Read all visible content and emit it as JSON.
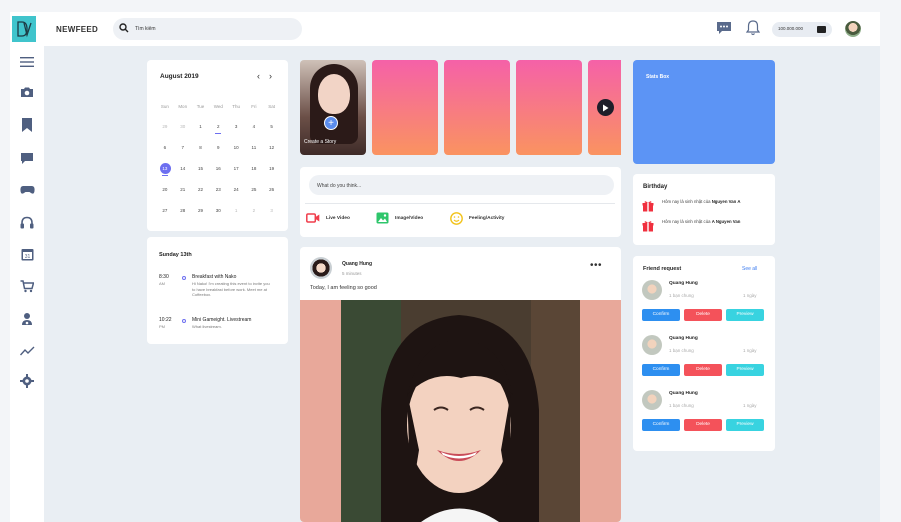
{
  "brand": "NEWFEED",
  "search": {
    "value": "Tìm kiếm"
  },
  "wallet": {
    "balance": "100.000.000"
  },
  "icons": {
    "sidebar": [
      "menu-icon",
      "camera-icon",
      "bookmark-icon",
      "chat-icon",
      "gamepad-icon",
      "headphones-icon",
      "calendar-icon",
      "cart-icon",
      "community-icon",
      "trend-icon",
      "settings-icon"
    ]
  },
  "calendar": {
    "month_label": "August  2019",
    "prev": "‹",
    "next": "›",
    "weekdays": [
      "Sun",
      "Mon",
      "Tue",
      "Wed",
      "Thu",
      "Fri",
      "Sat"
    ],
    "weeks": [
      [
        "29",
        "30",
        "1",
        "2",
        "3",
        "4",
        "5"
      ],
      [
        "6",
        "7",
        "8",
        "9",
        "10",
        "11",
        "12"
      ],
      [
        "13",
        "14",
        "15",
        "16",
        "17",
        "18",
        "19"
      ],
      [
        "20",
        "21",
        "22",
        "23",
        "24",
        "25",
        "26"
      ],
      [
        "27",
        "28",
        "29",
        "30",
        "1",
        "2",
        "3"
      ]
    ]
  },
  "agenda": {
    "date_label": "Sunday 13th",
    "items": [
      {
        "time": "8:30",
        "ampm": "AM",
        "title": "Breakfast with Nako",
        "desc": "Hi Nako! I'm creating this event to invite you to have breakfast before work. Meet me at Coffeebox."
      },
      {
        "time": "10:22",
        "ampm": "PM",
        "title": "Mini Gameight. Livestream",
        "desc": "What livestream."
      }
    ]
  },
  "stories": {
    "create_label": "Create a Story"
  },
  "composer": {
    "placeholder": "What do you think...",
    "actions": [
      "Live Video",
      "Image/Video",
      "Feeling/Activity"
    ]
  },
  "post": {
    "author": "Quang Hung",
    "time": "5 minutes",
    "text": "Today, I am feeling so good",
    "more": "•••"
  },
  "stats_box": {
    "title": "Stats Box"
  },
  "birthday": {
    "title": "Birthday",
    "items": [
      {
        "text": "Hôm nay là sinh nhật của ",
        "name": "Nguyen Van A"
      },
      {
        "text": "Hôm nay là sinh nhật của ",
        "name": "A Nguyen Van"
      }
    ]
  },
  "friend_request": {
    "title": "Friend request",
    "see_all": "See all",
    "items": [
      {
        "name": "Quang Hung",
        "mutual": "1 bạn chung",
        "ago": "1 ngày"
      },
      {
        "name": "Quang Hung",
        "mutual": "1 bạn chung",
        "ago": "1 ngày"
      },
      {
        "name": "Quang Hung",
        "mutual": "1 bạn chung",
        "ago": "1 ngày"
      }
    ],
    "confirm": "Confirm",
    "delete": "Delete",
    "preview": "Preview"
  },
  "colors": {
    "accent": "#40c4cc",
    "stats": "#5c94f5",
    "confirm": "#2d8ff0",
    "delete": "#f4525a",
    "preview": "#38d3e0",
    "selected_day": "#6d6ff0"
  }
}
